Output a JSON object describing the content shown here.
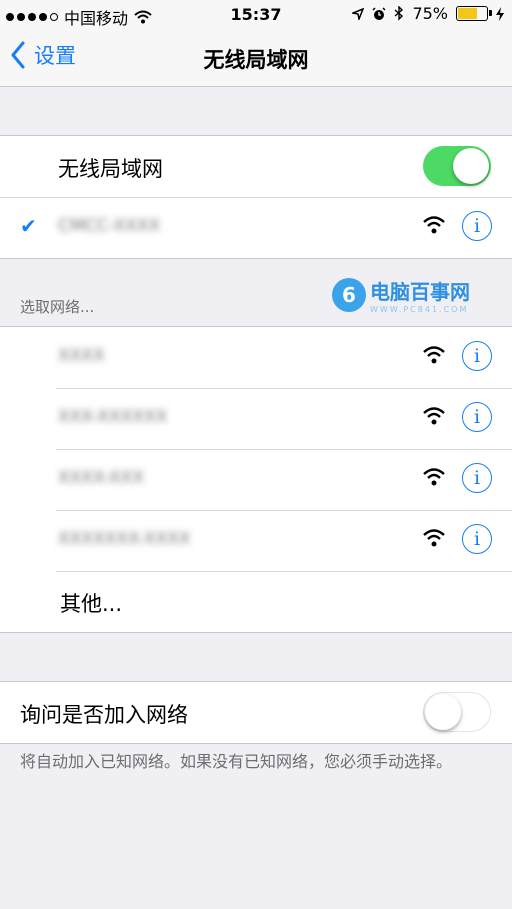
{
  "status_bar": {
    "carrier": "中国移动",
    "time": "15:37",
    "battery_percent": "75%",
    "battery_level": 0.75
  },
  "nav": {
    "back_label": "设置",
    "title": "无线局域网"
  },
  "wifi_toggle": {
    "label": "无线局域网",
    "on": true
  },
  "connected_network": {
    "name_redacted": "CMCC-XXXX"
  },
  "section_header": "选取网络...",
  "networks": [
    {
      "name_redacted": "XXXX"
    },
    {
      "name_redacted": "XXX-XXXXXX"
    },
    {
      "name_redacted": "XXXX-XXX"
    },
    {
      "name_redacted": "XXXXXXX-XXXX"
    }
  ],
  "other_label": "其他...",
  "ask_join": {
    "label": "询问是否加入网络",
    "on": false
  },
  "footer_text": "将自动加入已知网络。如果没有已知网络，您必须手动选择。",
  "watermark": {
    "title": "电脑百事网",
    "url": "WWW.PC841.COM",
    "logo_char": "6"
  },
  "colors": {
    "accent": "#147efb",
    "toggle_on": "#4cd964",
    "background": "#efeff4"
  }
}
